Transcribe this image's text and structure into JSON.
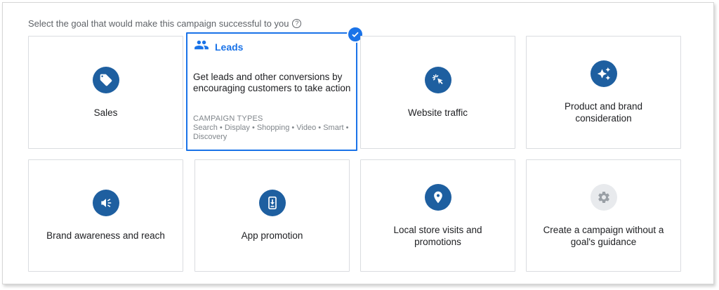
{
  "prompt": {
    "text": "Select the goal that would make this campaign successful to you",
    "help_glyph": "?"
  },
  "goals": [
    {
      "label": "Sales",
      "icon": "tag-icon"
    },
    {
      "label": "Leads",
      "icon": "people-icon",
      "selected": true,
      "description": "Get leads and other conversions by encouraging customers to take action",
      "types_heading": "CAMPAIGN TYPES",
      "types": "Search • Display • Shopping • Video • Smart • Discovery"
    },
    {
      "label": "Website traffic",
      "icon": "cursor-click-icon"
    },
    {
      "label": "Product and brand consideration",
      "icon": "sparkle-icon"
    },
    {
      "label": "Brand awareness and reach",
      "icon": "megaphone-icon"
    },
    {
      "label": "App promotion",
      "icon": "phone-download-icon"
    },
    {
      "label": "Local store visits and promotions",
      "icon": "location-pin-icon"
    },
    {
      "label": "Create a campaign without a goal's guidance",
      "icon": "gear-icon"
    }
  ],
  "colors": {
    "accent": "#1a73e8",
    "icon_bg": "#1e5fa0",
    "border": "#dadce0"
  }
}
